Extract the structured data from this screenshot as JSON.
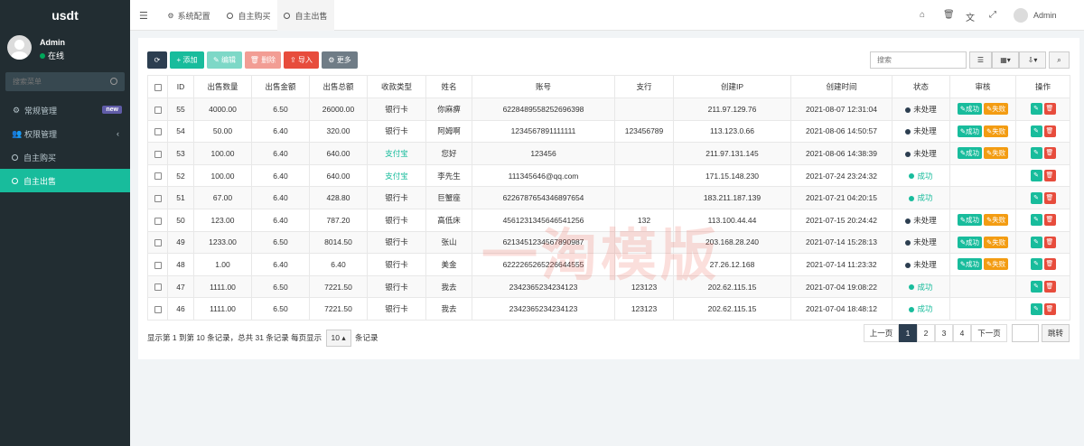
{
  "app": {
    "logo": "usdt"
  },
  "user": {
    "name": "Admin",
    "status": "在线"
  },
  "sidebar": {
    "search_placeholder": "搜索菜单",
    "items": [
      {
        "label": "常规管理",
        "icon": "gear-icon",
        "badge": "new"
      },
      {
        "label": "权限管理",
        "icon": "users-icon"
      },
      {
        "label": "自主购买",
        "icon": "circle-icon"
      },
      {
        "label": "自主出售",
        "icon": "circle-icon",
        "active": true
      }
    ]
  },
  "topbar": {
    "tabs": [
      {
        "label": "系统配置",
        "icon": "gear-icon"
      },
      {
        "label": "自主购买",
        "icon": "circle-icon"
      },
      {
        "label": "自主出售",
        "icon": "circle-icon",
        "active": true
      }
    ],
    "user": "Admin"
  },
  "toolbar": {
    "add": "添加",
    "edit": "编辑",
    "delete": "删除",
    "import": "导入",
    "more": "更多",
    "search_placeholder": "搜索"
  },
  "table": {
    "columns": [
      "ID",
      "出售数量",
      "出售金额",
      "出售总额",
      "收款类型",
      "姓名",
      "账号",
      "支行",
      "创建IP",
      "创建时间",
      "状态",
      "审核",
      "操作"
    ],
    "rows": [
      {
        "id": "55",
        "qty": "4000.00",
        "price": "6.50",
        "total": "26000.00",
        "type": "银行卡",
        "name": "你麻痹",
        "account": "6228489558252696398",
        "branch": "",
        "ip": "211.97.129.76",
        "time": "2021-08-07 12:31:04",
        "status": "未处理",
        "pending": true
      },
      {
        "id": "54",
        "qty": "50.00",
        "price": "6.40",
        "total": "320.00",
        "type": "银行卡",
        "name": "阿姆啊",
        "account": "1234567891111111",
        "branch": "123456789",
        "ip": "113.123.0.66",
        "time": "2021-08-06 14:50:57",
        "status": "未处理",
        "pending": true
      },
      {
        "id": "53",
        "qty": "100.00",
        "price": "6.40",
        "total": "640.00",
        "type": "支付宝",
        "name": "您好",
        "account": "123456",
        "branch": "",
        "ip": "211.97.131.145",
        "time": "2021-08-06 14:38:39",
        "status": "未处理",
        "pending": true
      },
      {
        "id": "52",
        "qty": "100.00",
        "price": "6.40",
        "total": "640.00",
        "type": "支付宝",
        "name": "李先生",
        "account": "111345646@qq.com",
        "branch": "",
        "ip": "171.15.148.230",
        "time": "2021-07-24 23:24:32",
        "status": "成功",
        "pending": false
      },
      {
        "id": "51",
        "qty": "67.00",
        "price": "6.40",
        "total": "428.80",
        "type": "银行卡",
        "name": "巨蟹座",
        "account": "6226787654346897654",
        "branch": "",
        "ip": "183.211.187.139",
        "time": "2021-07-21 04:20:15",
        "status": "成功",
        "pending": false
      },
      {
        "id": "50",
        "qty": "123.00",
        "price": "6.40",
        "total": "787.20",
        "type": "银行卡",
        "name": "高低床",
        "account": "4561231345646541256",
        "branch": "132",
        "ip": "113.100.44.44",
        "time": "2021-07-15 20:24:42",
        "status": "未处理",
        "pending": true
      },
      {
        "id": "49",
        "qty": "1233.00",
        "price": "6.50",
        "total": "8014.50",
        "type": "银行卡",
        "name": "张山",
        "account": "6213451234567890987",
        "branch": "",
        "ip": "203.168.28.240",
        "time": "2021-07-14 15:28:13",
        "status": "未处理",
        "pending": true
      },
      {
        "id": "48",
        "qty": "1.00",
        "price": "6.40",
        "total": "6.40",
        "type": "银行卡",
        "name": "美金",
        "account": "6222265265226644555",
        "branch": "",
        "ip": "27.26.12.168",
        "time": "2021-07-14 11:23:32",
        "status": "未处理",
        "pending": true
      },
      {
        "id": "47",
        "qty": "1111.00",
        "price": "6.50",
        "total": "7221.50",
        "type": "银行卡",
        "name": "我去",
        "account": "2342365234234123",
        "branch": "123123",
        "ip": "202.62.115.15",
        "time": "2021-07-04 19:08:22",
        "status": "成功",
        "pending": false
      },
      {
        "id": "46",
        "qty": "1111.00",
        "price": "6.50",
        "total": "7221.50",
        "type": "银行卡",
        "name": "我去",
        "account": "2342365234234123",
        "branch": "123123",
        "ip": "202.62.115.15",
        "time": "2021-07-04 18:48:12",
        "status": "成功",
        "pending": false
      }
    ],
    "audit": {
      "ok": "成功",
      "fail": "失败"
    }
  },
  "footer": {
    "text_before": "显示第 1 到第 10 条记录，总共 31 条记录 每页显示",
    "page_size": "10",
    "text_after": "条记录"
  },
  "pagination": {
    "prev": "上一页",
    "pages": [
      "1",
      "2",
      "3",
      "4"
    ],
    "next": "下一页",
    "goto": "跳转"
  },
  "watermark": "一淘模版",
  "colors": {
    "sidebar": "#222d32",
    "accent": "#18bc9c",
    "danger": "#e74c3c",
    "warning": "#f39c12",
    "dark": "#2c3e50"
  }
}
